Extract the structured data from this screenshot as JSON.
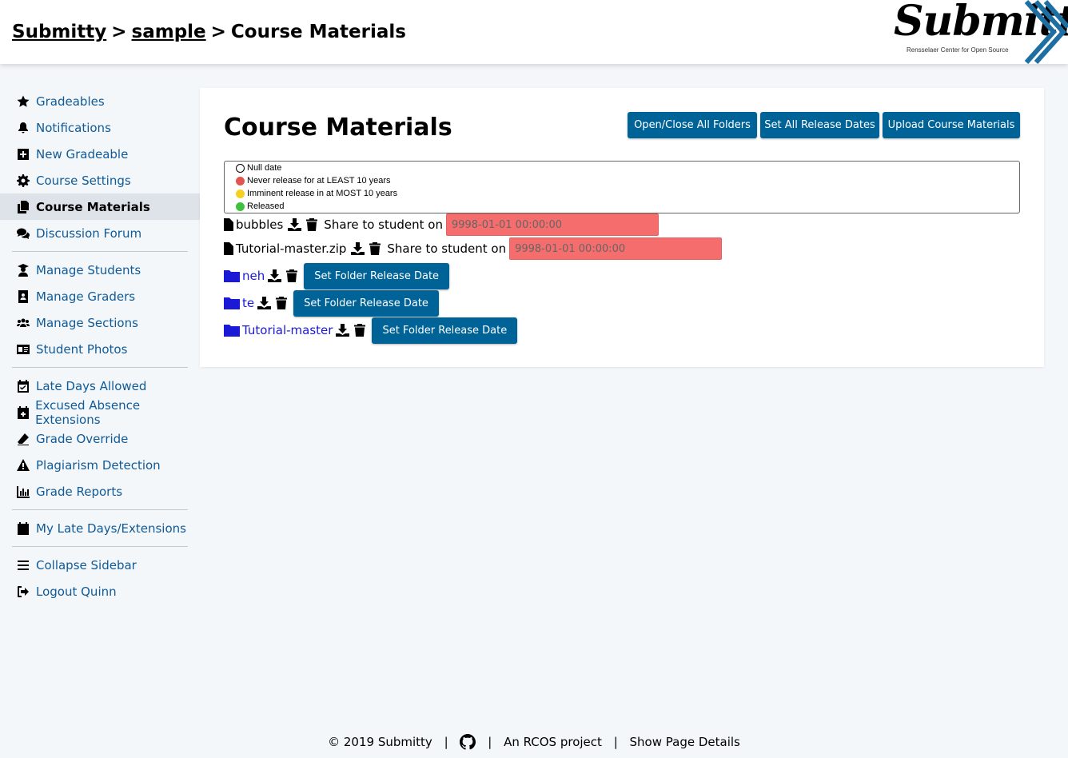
{
  "breadcrumb": {
    "root": "Submitty",
    "course": "sample",
    "current": "Course Materials",
    "separator": ">"
  },
  "logo": {
    "text": "Submitty",
    "subtitle": "Rensselaer Center for Open Source"
  },
  "sidebar": {
    "items": [
      {
        "label": "Gradeables",
        "icon": "star-icon"
      },
      {
        "label": "Notifications",
        "icon": "bell-icon"
      },
      {
        "label": "New Gradeable",
        "icon": "plus-square-icon"
      },
      {
        "label": "Course Settings",
        "icon": "gear-icon"
      },
      {
        "label": "Course Materials",
        "icon": "copy-icon",
        "active": true
      },
      {
        "label": "Discussion Forum",
        "icon": "comments-icon"
      },
      {
        "label": "Manage Students",
        "icon": "user-graduate-icon"
      },
      {
        "label": "Manage Graders",
        "icon": "address-book-icon"
      },
      {
        "label": "Manage Sections",
        "icon": "users-icon"
      },
      {
        "label": "Student Photos",
        "icon": "id-card-icon"
      },
      {
        "label": "Late Days Allowed",
        "icon": "calendar-check-icon"
      },
      {
        "label": "Excused Absence Extensions",
        "icon": "calendar-plus-icon"
      },
      {
        "label": "Grade Override",
        "icon": "eraser-icon"
      },
      {
        "label": "Plagiarism Detection",
        "icon": "warning-icon"
      },
      {
        "label": "Grade Reports",
        "icon": "chart-icon"
      },
      {
        "label": "My Late Days/Extensions",
        "icon": "calendar-icon"
      },
      {
        "label": "Collapse Sidebar",
        "icon": "bars-icon"
      },
      {
        "label": "Logout Quinn",
        "icon": "sign-out-icon"
      }
    ]
  },
  "main": {
    "title": "Course Materials",
    "buttons": {
      "toggle_folders": "Open/Close All Folders",
      "set_release": "Set All Release Dates",
      "upload": "Upload Course Materials"
    },
    "legend": [
      {
        "label": "Null date",
        "color": "#ffffff"
      },
      {
        "label": "Never release for at LEAST 10 years",
        "color": "#e0554f"
      },
      {
        "label": "Imminent release in at MOST 10 years",
        "color": "#f5d020"
      },
      {
        "label": "Released",
        "color": "#3fc13f"
      }
    ],
    "files": [
      {
        "name": "bubbles",
        "share_label": "Share to student on",
        "date": "9998-01-01 00:00:00"
      },
      {
        "name": "Tutorial-master.zip",
        "share_label": "Share to student on",
        "date": "9998-01-01 00:00:00"
      }
    ],
    "folders": [
      {
        "name": "neh",
        "button": "Set Folder Release Date"
      },
      {
        "name": "te",
        "button": "Set Folder Release Date"
      },
      {
        "name": "Tutorial-master",
        "button": "Set Folder Release Date"
      }
    ]
  },
  "footer": {
    "copyright": "© 2019 Submitty",
    "rcos": "An RCOS project",
    "details": "Show Page Details",
    "separator": "|"
  },
  "colors": {
    "accent": "#006398",
    "link": "#0f5a97",
    "folder": "#1a1ad6",
    "date_bg": "#f56d6d"
  }
}
